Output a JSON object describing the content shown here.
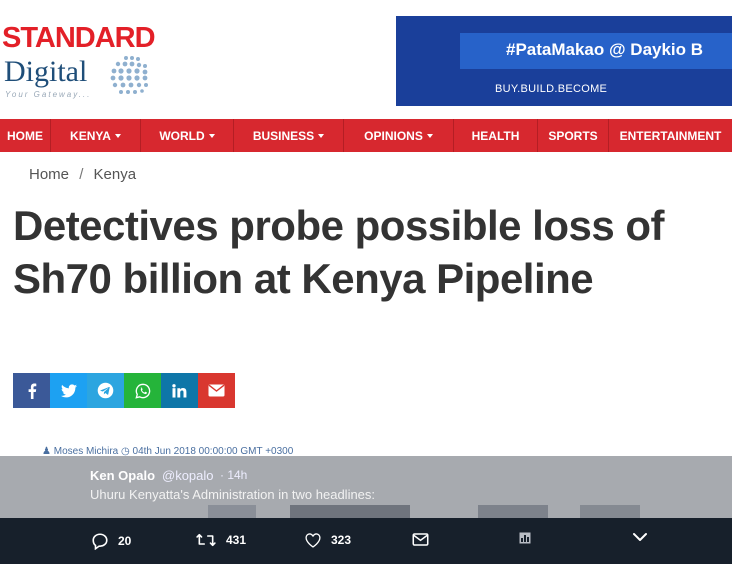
{
  "logo": {
    "name": "STANDARD",
    "sub": "Digital",
    "tagline": "Your Gateway..."
  },
  "ad": {
    "hashtag": "#PataMakao @ Daykio B",
    "tagline": "BUY.BUILD.BECOME"
  },
  "nav": [
    {
      "label": "HOME",
      "dropdown": false
    },
    {
      "label": "KENYA",
      "dropdown": true
    },
    {
      "label": "WORLD",
      "dropdown": true
    },
    {
      "label": "BUSINESS",
      "dropdown": true
    },
    {
      "label": "OPINIONS",
      "dropdown": true
    },
    {
      "label": "HEALTH",
      "dropdown": false
    },
    {
      "label": "SPORTS",
      "dropdown": false
    },
    {
      "label": "ENTERTAINMENT",
      "dropdown": false
    }
  ],
  "breadcrumb": {
    "home": "Home",
    "separator": "/",
    "section": "Kenya"
  },
  "article": {
    "title": "Detectives probe possible loss of Sh70 billion at Kenya Pipeline",
    "author": "Moses Michira",
    "date": "04th Jun 2018 00:00:00 GMT +0300"
  },
  "share": [
    {
      "icon": "facebook-icon",
      "color": "#3b5998"
    },
    {
      "icon": "twitter-icon",
      "color": "#1da1f2"
    },
    {
      "icon": "telegram-icon",
      "color": "#2ca5e0"
    },
    {
      "icon": "whatsapp-icon",
      "color": "#25b43a"
    },
    {
      "icon": "linkedin-icon",
      "color": "#0e76a8"
    },
    {
      "icon": "email-icon",
      "color": "#d9372f"
    }
  ],
  "tweet": {
    "name": "Ken Opalo",
    "handle": "@kopalo",
    "time": "· 14h",
    "text": "Uhuru Kenyatta's Administration in two headlines:"
  },
  "tweet_actions": {
    "replies": "20",
    "retweets": "431",
    "likes": "323",
    "icons": [
      "reply-icon",
      "retweet-icon",
      "like-icon",
      "message-icon",
      "analytics-icon",
      "chevron-down-icon"
    ]
  },
  "colors": {
    "brand_red": "#d7282f",
    "logo_blue": "#1f4e79",
    "ad_blue": "#1a3f9a",
    "tweet_bar": "#17202b"
  }
}
